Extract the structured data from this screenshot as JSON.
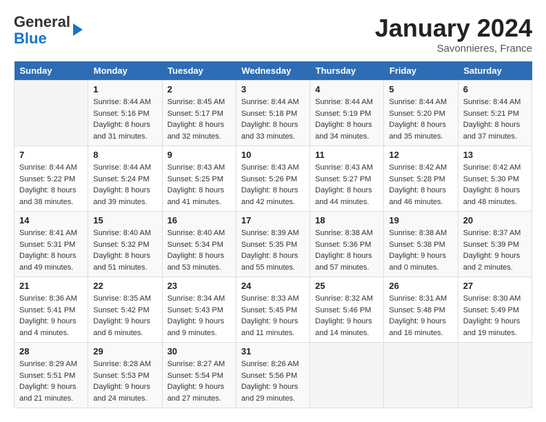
{
  "header": {
    "logo_line1": "General",
    "logo_line2": "Blue",
    "month_title": "January 2024",
    "location": "Savonnieres, France"
  },
  "calendar": {
    "days_of_week": [
      "Sunday",
      "Monday",
      "Tuesday",
      "Wednesday",
      "Thursday",
      "Friday",
      "Saturday"
    ],
    "weeks": [
      [
        {
          "day": "",
          "sunrise": "",
          "sunset": "",
          "daylight": ""
        },
        {
          "day": "1",
          "sunrise": "Sunrise: 8:44 AM",
          "sunset": "Sunset: 5:16 PM",
          "daylight": "Daylight: 8 hours and 31 minutes."
        },
        {
          "day": "2",
          "sunrise": "Sunrise: 8:45 AM",
          "sunset": "Sunset: 5:17 PM",
          "daylight": "Daylight: 8 hours and 32 minutes."
        },
        {
          "day": "3",
          "sunrise": "Sunrise: 8:44 AM",
          "sunset": "Sunset: 5:18 PM",
          "daylight": "Daylight: 8 hours and 33 minutes."
        },
        {
          "day": "4",
          "sunrise": "Sunrise: 8:44 AM",
          "sunset": "Sunset: 5:19 PM",
          "daylight": "Daylight: 8 hours and 34 minutes."
        },
        {
          "day": "5",
          "sunrise": "Sunrise: 8:44 AM",
          "sunset": "Sunset: 5:20 PM",
          "daylight": "Daylight: 8 hours and 35 minutes."
        },
        {
          "day": "6",
          "sunrise": "Sunrise: 8:44 AM",
          "sunset": "Sunset: 5:21 PM",
          "daylight": "Daylight: 8 hours and 37 minutes."
        }
      ],
      [
        {
          "day": "7",
          "sunrise": "Sunrise: 8:44 AM",
          "sunset": "Sunset: 5:22 PM",
          "daylight": "Daylight: 8 hours and 38 minutes."
        },
        {
          "day": "8",
          "sunrise": "Sunrise: 8:44 AM",
          "sunset": "Sunset: 5:24 PM",
          "daylight": "Daylight: 8 hours and 39 minutes."
        },
        {
          "day": "9",
          "sunrise": "Sunrise: 8:43 AM",
          "sunset": "Sunset: 5:25 PM",
          "daylight": "Daylight: 8 hours and 41 minutes."
        },
        {
          "day": "10",
          "sunrise": "Sunrise: 8:43 AM",
          "sunset": "Sunset: 5:26 PM",
          "daylight": "Daylight: 8 hours and 42 minutes."
        },
        {
          "day": "11",
          "sunrise": "Sunrise: 8:43 AM",
          "sunset": "Sunset: 5:27 PM",
          "daylight": "Daylight: 8 hours and 44 minutes."
        },
        {
          "day": "12",
          "sunrise": "Sunrise: 8:42 AM",
          "sunset": "Sunset: 5:28 PM",
          "daylight": "Daylight: 8 hours and 46 minutes."
        },
        {
          "day": "13",
          "sunrise": "Sunrise: 8:42 AM",
          "sunset": "Sunset: 5:30 PM",
          "daylight": "Daylight: 8 hours and 48 minutes."
        }
      ],
      [
        {
          "day": "14",
          "sunrise": "Sunrise: 8:41 AM",
          "sunset": "Sunset: 5:31 PM",
          "daylight": "Daylight: 8 hours and 49 minutes."
        },
        {
          "day": "15",
          "sunrise": "Sunrise: 8:40 AM",
          "sunset": "Sunset: 5:32 PM",
          "daylight": "Daylight: 8 hours and 51 minutes."
        },
        {
          "day": "16",
          "sunrise": "Sunrise: 8:40 AM",
          "sunset": "Sunset: 5:34 PM",
          "daylight": "Daylight: 8 hours and 53 minutes."
        },
        {
          "day": "17",
          "sunrise": "Sunrise: 8:39 AM",
          "sunset": "Sunset: 5:35 PM",
          "daylight": "Daylight: 8 hours and 55 minutes."
        },
        {
          "day": "18",
          "sunrise": "Sunrise: 8:38 AM",
          "sunset": "Sunset: 5:36 PM",
          "daylight": "Daylight: 8 hours and 57 minutes."
        },
        {
          "day": "19",
          "sunrise": "Sunrise: 8:38 AM",
          "sunset": "Sunset: 5:38 PM",
          "daylight": "Daylight: 9 hours and 0 minutes."
        },
        {
          "day": "20",
          "sunrise": "Sunrise: 8:37 AM",
          "sunset": "Sunset: 5:39 PM",
          "daylight": "Daylight: 9 hours and 2 minutes."
        }
      ],
      [
        {
          "day": "21",
          "sunrise": "Sunrise: 8:36 AM",
          "sunset": "Sunset: 5:41 PM",
          "daylight": "Daylight: 9 hours and 4 minutes."
        },
        {
          "day": "22",
          "sunrise": "Sunrise: 8:35 AM",
          "sunset": "Sunset: 5:42 PM",
          "daylight": "Daylight: 9 hours and 6 minutes."
        },
        {
          "day": "23",
          "sunrise": "Sunrise: 8:34 AM",
          "sunset": "Sunset: 5:43 PM",
          "daylight": "Daylight: 9 hours and 9 minutes."
        },
        {
          "day": "24",
          "sunrise": "Sunrise: 8:33 AM",
          "sunset": "Sunset: 5:45 PM",
          "daylight": "Daylight: 9 hours and 11 minutes."
        },
        {
          "day": "25",
          "sunrise": "Sunrise: 8:32 AM",
          "sunset": "Sunset: 5:46 PM",
          "daylight": "Daylight: 9 hours and 14 minutes."
        },
        {
          "day": "26",
          "sunrise": "Sunrise: 8:31 AM",
          "sunset": "Sunset: 5:48 PM",
          "daylight": "Daylight: 9 hours and 16 minutes."
        },
        {
          "day": "27",
          "sunrise": "Sunrise: 8:30 AM",
          "sunset": "Sunset: 5:49 PM",
          "daylight": "Daylight: 9 hours and 19 minutes."
        }
      ],
      [
        {
          "day": "28",
          "sunrise": "Sunrise: 8:29 AM",
          "sunset": "Sunset: 5:51 PM",
          "daylight": "Daylight: 9 hours and 21 minutes."
        },
        {
          "day": "29",
          "sunrise": "Sunrise: 8:28 AM",
          "sunset": "Sunset: 5:53 PM",
          "daylight": "Daylight: 9 hours and 24 minutes."
        },
        {
          "day": "30",
          "sunrise": "Sunrise: 8:27 AM",
          "sunset": "Sunset: 5:54 PM",
          "daylight": "Daylight: 9 hours and 27 minutes."
        },
        {
          "day": "31",
          "sunrise": "Sunrise: 8:26 AM",
          "sunset": "Sunset: 5:56 PM",
          "daylight": "Daylight: 9 hours and 29 minutes."
        },
        {
          "day": "",
          "sunrise": "",
          "sunset": "",
          "daylight": ""
        },
        {
          "day": "",
          "sunrise": "",
          "sunset": "",
          "daylight": ""
        },
        {
          "day": "",
          "sunrise": "",
          "sunset": "",
          "daylight": ""
        }
      ]
    ]
  }
}
